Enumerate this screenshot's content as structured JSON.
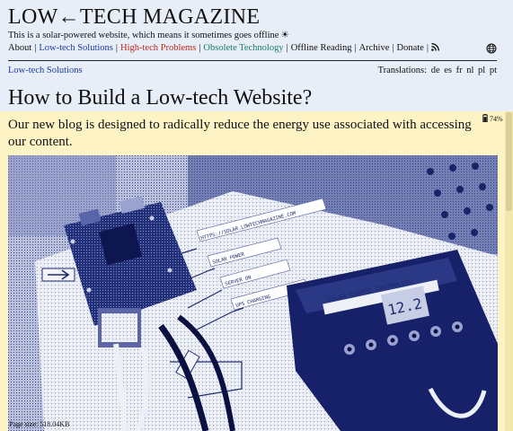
{
  "header": {
    "site_title": "LOW←TECH MAGAZINE",
    "tagline": "This is a solar-powered website, which means it sometimes goes offline",
    "tagline_icon": "sun-icon"
  },
  "nav": {
    "items": [
      {
        "label": "About",
        "color": "#111111"
      },
      {
        "label": "Low-tech Solutions",
        "color": "#1b3aa8"
      },
      {
        "label": "High-tech Problems",
        "color": "#c0261c"
      },
      {
        "label": "Obsolete Technology",
        "color": "#1a7a6c"
      },
      {
        "label": "Offline Reading",
        "color": "#111111"
      },
      {
        "label": "Archive",
        "color": "#111111"
      },
      {
        "label": "Donate",
        "color": "#111111"
      }
    ],
    "rss_icon": "rss-icon",
    "language_icon": "globe-icon"
  },
  "breadcrumb": {
    "label": "Low-tech Solutions"
  },
  "translations": {
    "label": "Translations:",
    "languages": [
      "de",
      "es",
      "fr",
      "nl",
      "pl",
      "pt"
    ]
  },
  "article": {
    "title": "How to Build a Low-tech Website?",
    "lede": "Our new blog is designed to radically reduce the energy use associated with accessing our content.",
    "battery_level": "74%",
    "battery_icon": "battery-icon",
    "page_size": "Page size: 518.04KB"
  },
  "photo_labels": {
    "url_tag": "HTTPS://SOLAR.LOWTECHMAGAZINE.COM",
    "solar_power": "SOLAR POWER",
    "server_on": "SERVER ON",
    "ups_charging": "UPS CHARGING",
    "controller": "SOLAR CHARGE CONTROLLER",
    "display": "12.2"
  },
  "colors": {
    "header_bg": "#e8eef8",
    "band_bg": "#fdf3c4",
    "photo_dark": "#1c2a6e",
    "photo_light": "#e6e8f2"
  }
}
